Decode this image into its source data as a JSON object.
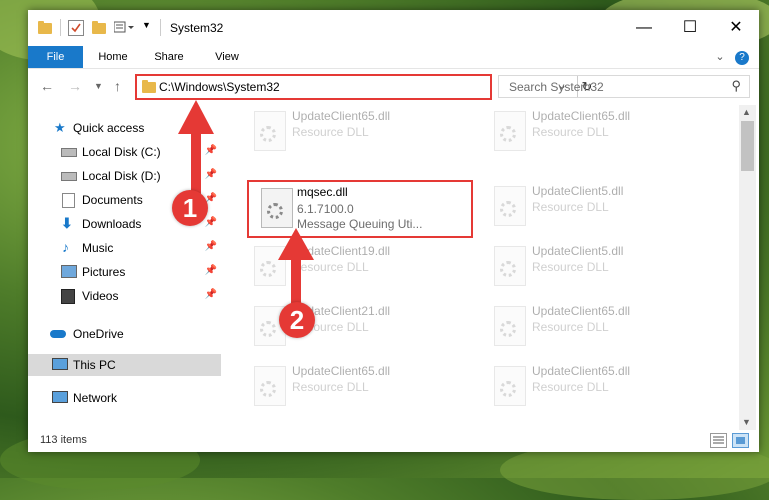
{
  "window": {
    "title": "System32"
  },
  "ribbon": {
    "tabs": [
      "File",
      "Home",
      "Share",
      "View"
    ]
  },
  "address": {
    "path": "C:\\Windows\\System32",
    "search_placeholder": "Search System32"
  },
  "nav": {
    "items": [
      {
        "label": "Quick access",
        "icon": "star-icon"
      },
      {
        "label": "Local Disk (C:)",
        "icon": "drive-icon"
      },
      {
        "label": "Local Disk (D:)",
        "icon": "drive-icon"
      },
      {
        "label": "Documents",
        "icon": "documents-icon"
      },
      {
        "label": "Downloads",
        "icon": "download-icon"
      },
      {
        "label": "Music",
        "icon": "music-icon"
      },
      {
        "label": "Pictures",
        "icon": "pictures-icon"
      },
      {
        "label": "Videos",
        "icon": "videos-icon"
      },
      {
        "label": "OneDrive",
        "icon": "cloud-icon"
      },
      {
        "label": "This PC",
        "icon": "computer-icon"
      },
      {
        "label": "Network",
        "icon": "network-icon"
      }
    ]
  },
  "files": {
    "highlighted": {
      "name": "mqsec.dll",
      "version": "6.1.7100.0",
      "description": "Message Queuing Uti..."
    },
    "items": [
      {
        "name": "UpdateClient65.dll",
        "type": "Resource DLL"
      },
      {
        "name": "UpdateClient65.dll",
        "type": "Resource DLL"
      },
      {
        "name": "UpdateClient5.dll",
        "type": "Resource DLL"
      },
      {
        "name": "UpdateClient19.dll",
        "type": "Resource DLL"
      },
      {
        "name": "UpdateClient5.dll",
        "type": "Resource DLL"
      },
      {
        "name": "UpdateClient21.dll",
        "type": "Resource DLL"
      },
      {
        "name": "UpdateClient65.dll",
        "type": "Resource DLL"
      },
      {
        "name": "UpdateClient65.dll",
        "type": "Resource DLL"
      },
      {
        "name": "UpdateClient65.dll",
        "type": "Resource DLL"
      }
    ]
  },
  "status": {
    "item_count": "113 items"
  },
  "annotations": {
    "badge1": "1",
    "badge2": "2",
    "color": "#e53935"
  }
}
